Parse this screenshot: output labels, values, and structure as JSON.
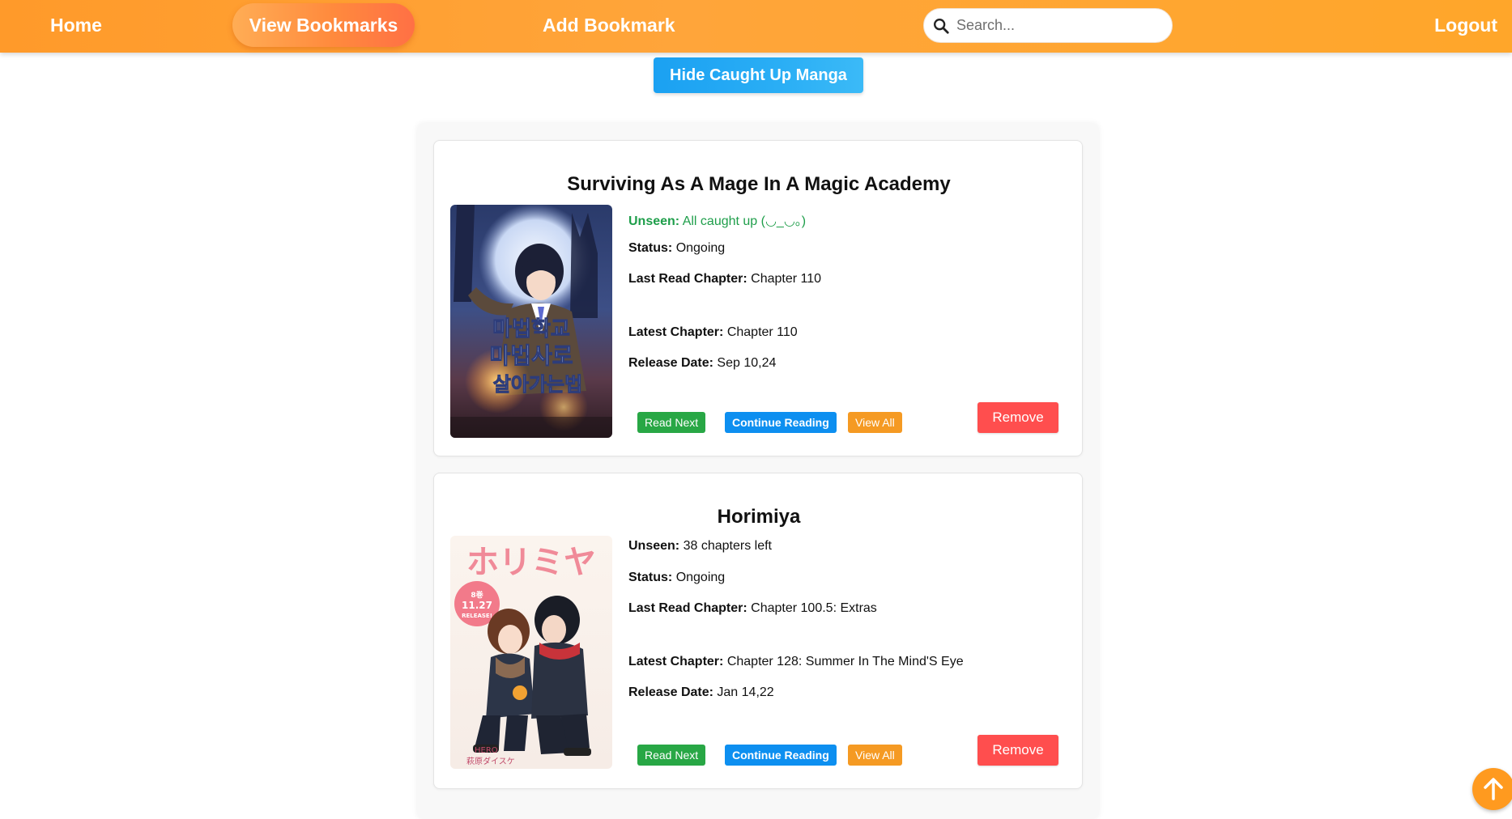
{
  "nav": {
    "home": "Home",
    "view_bookmarks": "View Bookmarks",
    "add_bookmark": "Add Bookmark",
    "logout": "Logout",
    "search_placeholder": "Search...",
    "search_icon": "search-icon"
  },
  "controls": {
    "hide_caught_up": "Hide Caught Up Manga"
  },
  "labels": {
    "unseen": "Unseen:",
    "status": "Status:",
    "last_read": "Last Read Chapter:",
    "latest": "Latest Chapter:",
    "release": "Release Date:",
    "read_next": "Read Next",
    "continue_reading": "Continue Reading",
    "view_all": "View All",
    "remove": "Remove"
  },
  "bookmarks": [
    {
      "title": "Surviving As A Mage In A Magic Academy",
      "unseen": "All caught up (◡_◡。)",
      "caught_up": true,
      "status": "Ongoing",
      "last_read": "Chapter 110",
      "latest": "Chapter 110",
      "release": "Sep 10,24",
      "cover_text": "마법학교 마법사로 살아가는 법"
    },
    {
      "title": "Horimiya",
      "unseen": "38 chapters left",
      "caught_up": false,
      "status": "Ongoing",
      "last_read": "Chapter 100.5: Extras",
      "latest": "Chapter 128: Summer In The Mind'S Eye",
      "release": "Jan 14,22",
      "cover_text": "ホリミヤ",
      "cover_badge": "8巻 11.27 RELEASE!"
    }
  ],
  "colors": {
    "nav_orange": "#ffa53a",
    "caught_up_green": "#1e9e4a",
    "read_next": "#28a745",
    "continue_reading": "#0d8ff0",
    "view_all": "#f59a23",
    "remove": "#ff4e4e",
    "hide_button": "#2aaef5"
  },
  "scroll_top_icon": "arrow-up-icon"
}
